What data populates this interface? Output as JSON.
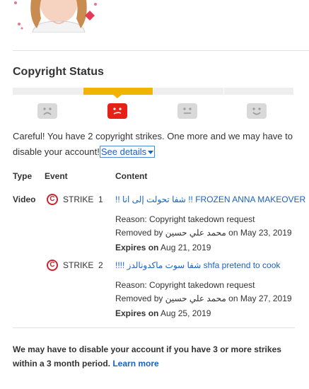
{
  "section_title": "Copyright Status",
  "status_meter": {
    "segments": 4,
    "active_segment": 2,
    "active_color": "#f0b400"
  },
  "warning": {
    "text": "Careful! You have 2 copyright strikes. One more and we may have to disable your account!",
    "see_details": "See details"
  },
  "table": {
    "headers": {
      "type": "Type",
      "event": "Event",
      "content": "Content"
    },
    "type_value": "Video",
    "strikes": [
      {
        "event_label": "STRIKE",
        "event_number": "1",
        "title": "!! شفا تحولت إلى انا !! FROZEN ANNA MAKEOVER",
        "reason": "Reason: Copyright takedown request",
        "removed_prefix": "Removed by",
        "removed_by": "محمد علي حسين",
        "removed_on": "on May 23, 2019",
        "expires_label": "Expires on",
        "expires_date": "Aug 21, 2019"
      },
      {
        "event_label": "STRIKE",
        "event_number": "2",
        "title": "!!!! شفا سوت ماكدونالدز shfa pretend to cook",
        "reason": "Reason: Copyright takedown request",
        "removed_prefix": "Removed by",
        "removed_by": "محمد علي حسين",
        "removed_on": "on May 27, 2019",
        "expires_label": "Expires on",
        "expires_date": "Aug 25, 2019"
      }
    ]
  },
  "footer": {
    "text": "We may have to disable your account if you have 3 or more strikes within a 3 month period.",
    "learn_more": "Learn more"
  }
}
